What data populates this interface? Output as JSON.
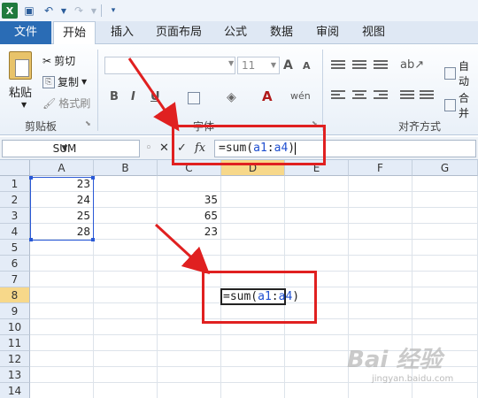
{
  "qat": {
    "undo_icon": "undo-icon",
    "redo_icon": "redo-icon"
  },
  "tabs": [
    {
      "label": "文件"
    },
    {
      "label": "开始"
    },
    {
      "label": "插入"
    },
    {
      "label": "页面布局"
    },
    {
      "label": "公式"
    },
    {
      "label": "数据"
    },
    {
      "label": "审阅"
    },
    {
      "label": "视图"
    }
  ],
  "ribbon": {
    "paste": "粘贴",
    "cut": "剪切",
    "copy": "复制",
    "format_painter": "格式刷",
    "clipboard_group": "剪贴板",
    "font_size": "11",
    "font_group": "字体",
    "align_group": "对齐方式",
    "wrap": "自动",
    "merge": "合并",
    "bold": "B",
    "italic": "I",
    "underline": "U",
    "grow_font": "A",
    "shrink_font": "A",
    "phonetic": "wén"
  },
  "formula_bar": {
    "name_box": "SUM",
    "cancel": "✕",
    "enter": "✓",
    "fx": "fx",
    "formula_prefix": "=sum(",
    "formula_ref1": "a1",
    "formula_sep": ":",
    "formula_ref2": "a4",
    "formula_suffix": ")"
  },
  "columns": [
    "A",
    "B",
    "C",
    "D",
    "E",
    "F",
    "G"
  ],
  "rows": [
    "1",
    "2",
    "3",
    "4",
    "5",
    "6",
    "7",
    "8",
    "9",
    "10",
    "11",
    "12",
    "13",
    "14"
  ],
  "cells": {
    "A1": "23",
    "A2": "24",
    "A3": "25",
    "A4": "28",
    "C2": "35",
    "C3": "65",
    "C4": "23"
  },
  "editing_cell": {
    "prefix": "=sum(",
    "ref1": "a1",
    "sep": ":",
    "ref2": "a4",
    "suffix": ")"
  },
  "watermark": {
    "main": "Bai 经验",
    "sub": "jingyan.baidu.com"
  },
  "colors": {
    "annotation": "#e02020",
    "file_tab": "#2a6cb5",
    "active_header": "#f7d88a",
    "range_border": "#2a59d6"
  }
}
